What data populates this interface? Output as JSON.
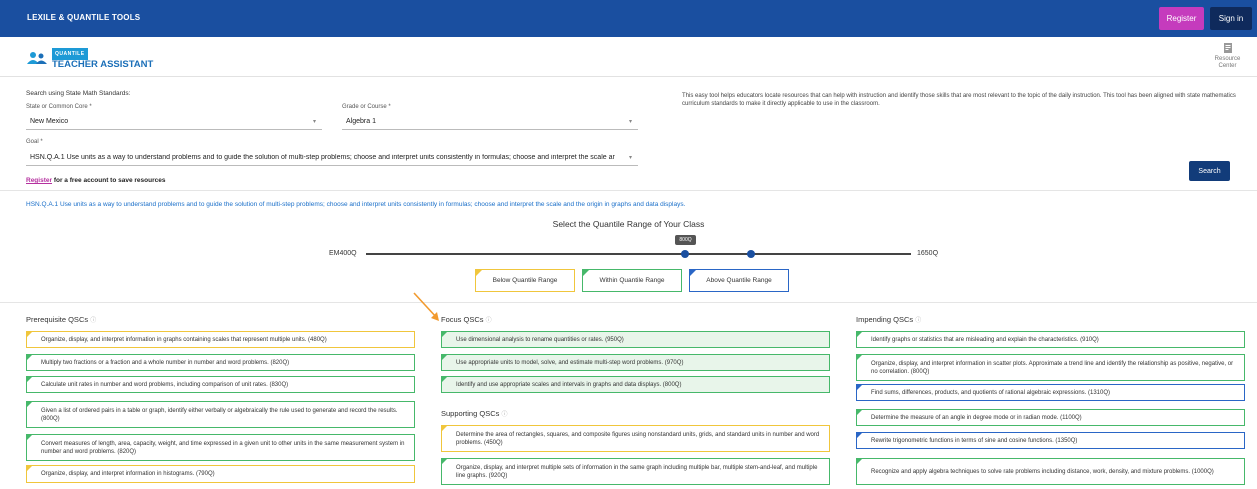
{
  "topbar": {
    "title": "LEXILE & QUANTILE TOOLS",
    "register": "Register",
    "signin": "Sign in"
  },
  "logo": {
    "badge": "QUANTILE",
    "name": "TEACHER ASSISTANT"
  },
  "resource_center": {
    "line1": "Resource",
    "line2": "Center"
  },
  "search": {
    "heading": "Search using State Math Standards:",
    "state_label": "State or Common Core *",
    "state_value": "New Mexico",
    "grade_label": "Grade or Course *",
    "grade_value": "Algebra 1",
    "goal_label": "Goal *",
    "goal_value": "HSN.Q.A.1 Use units as a way to understand problems and to guide the solution of multi-step problems; choose and interpret units consistently in formulas; choose and interpret the scale ar",
    "button": "Search"
  },
  "description": "This easy tool helps educators locate resources that can help with instruction and identify those skills that are most relevant to the topic of the daily instruction. This tool has been aligned with state mathematics curriculum standards to make it directly applicable to use in the classroom.",
  "register_line": {
    "link": "Register",
    "rest": "for a free account to save resources"
  },
  "goal_link": "HSN.Q.A.1 Use units as a way to understand problems and to guide the solution of multi-step problems; choose and interpret units consistently in formulas; choose and interpret the scale and the origin in graphs and data displays.",
  "range": {
    "title": "Select the Quantile Range of Your Class",
    "min": "EM400Q",
    "max": "1650Q",
    "tooltip": "800Q",
    "min_value": -400,
    "max_value": 1650,
    "low": 800,
    "high": 1050
  },
  "legend": {
    "below": "Below Quantile Range",
    "within": "Within Quantile Range",
    "above": "Above Quantile Range"
  },
  "colors": {
    "below": "#f0c63c",
    "within": "#46b86a",
    "above": "#2a66c6",
    "accent": "#1a4fa0"
  },
  "prerequisite": {
    "heading": "Prerequisite QSCs",
    "items": [
      {
        "text": "Organize, display, and interpret information in graphs containing scales that represent multiple units. (480Q)",
        "range": "below"
      },
      {
        "text": "Multiply two fractions or a fraction and a whole number in number and word problems. (820Q)",
        "range": "within"
      },
      {
        "text": "Calculate unit rates in number and word problems, including comparison of unit rates. (830Q)",
        "range": "within"
      },
      {
        "text": "Given a list of ordered pairs in a table or graph, identify either verbally or algebraically the rule used to generate and record the results. (800Q)",
        "range": "within"
      },
      {
        "text": "Convert measures of length, area, capacity, weight, and time expressed in a given unit to other units in the same measurement system in number and word problems. (820Q)",
        "range": "within"
      },
      {
        "text": "Organize, display, and interpret information in histograms. (790Q)",
        "range": "below"
      }
    ]
  },
  "focus": {
    "heading": "Focus QSCs",
    "items": [
      {
        "text": "Use dimensional analysis to rename quantities or rates. (950Q)",
        "range": "within"
      },
      {
        "text": "Use appropriate units to model, solve, and estimate multi-step word problems. (970Q)",
        "range": "within"
      },
      {
        "text": "Identify and use appropriate scales and intervals in graphs and data displays. (800Q)",
        "range": "within"
      }
    ]
  },
  "supporting": {
    "heading": "Supporting QSCs",
    "items": [
      {
        "text": "Determine the area of rectangles, squares, and composite figures using nonstandard units, grids, and standard units in number and word problems. (450Q)",
        "range": "below"
      },
      {
        "text": "Organize, display, and interpret multiple sets of information in the same graph including multiple bar, multiple stem-and-leaf, and multiple line graphs. (920Q)",
        "range": "within"
      }
    ]
  },
  "impending": {
    "heading": "Impending QSCs",
    "items": [
      {
        "text": "Identify graphs or statistics that are misleading and explain the characteristics. (910Q)",
        "range": "within"
      },
      {
        "text": "Organize, display, and interpret information in scatter plots. Approximate a trend line and identify the relationship as positive, negative, or no correlation. (800Q)",
        "range": "within"
      },
      {
        "text": "Find sums, differences, products, and quotients of rational algebraic expressions. (1310Q)",
        "range": "above"
      },
      {
        "text": "Determine the measure of an angle in degree mode or in radian mode. (1100Q)",
        "range": "within"
      },
      {
        "text": "Rewrite trigonometric functions in terms of sine and cosine functions. (1350Q)",
        "range": "above"
      },
      {
        "text": "Recognize and apply algebra techniques to solve rate problems including distance, work, density, and mixture problems. (1000Q)",
        "range": "within"
      }
    ]
  }
}
